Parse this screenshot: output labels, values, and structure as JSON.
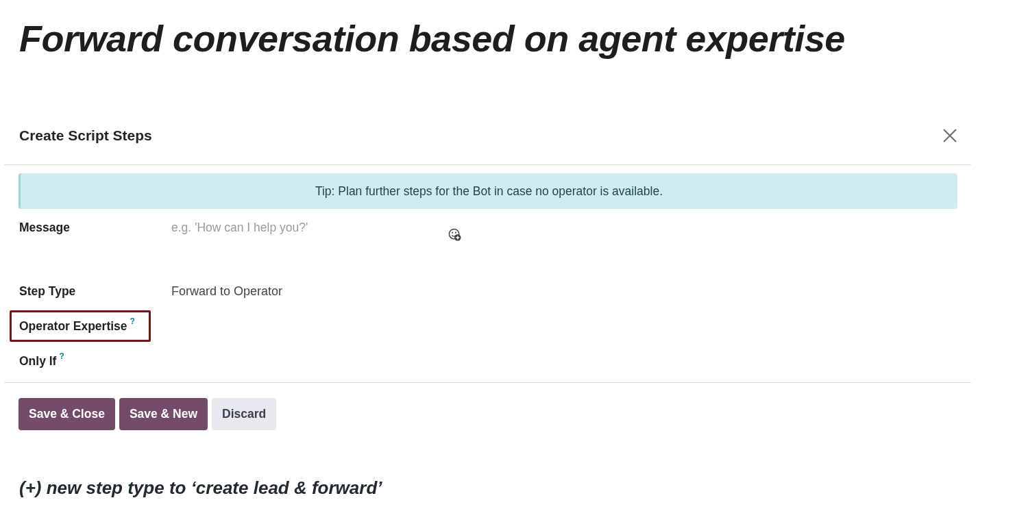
{
  "headline": "Forward conversation based on agent expertise",
  "dialog": {
    "title": "Create Script Steps",
    "alert": {
      "text": "Tip: Plan further steps for the Bot in case no operator is available."
    },
    "fields": [
      {
        "label": "Message",
        "kind": "textarea",
        "placeholder": "e.g. 'How can I help you?'",
        "highlighted": false
      },
      {
        "label": "Step Type",
        "kind": "select",
        "value": "Forward to Operator",
        "highlighted": false
      },
      {
        "label": "Operator Expertise",
        "help": "?",
        "kind": "tags",
        "highlighted": true
      },
      {
        "label": "Only If",
        "help": "?",
        "kind": "tags",
        "highlighted": false
      }
    ],
    "buttons": [
      {
        "label": "Save & Close",
        "kind": "primary"
      },
      {
        "label": "Save & New",
        "kind": "primary"
      },
      {
        "label": "Discard",
        "kind": "secondary"
      }
    ]
  },
  "note": "(+) new step type to ‘create lead & forward’"
}
